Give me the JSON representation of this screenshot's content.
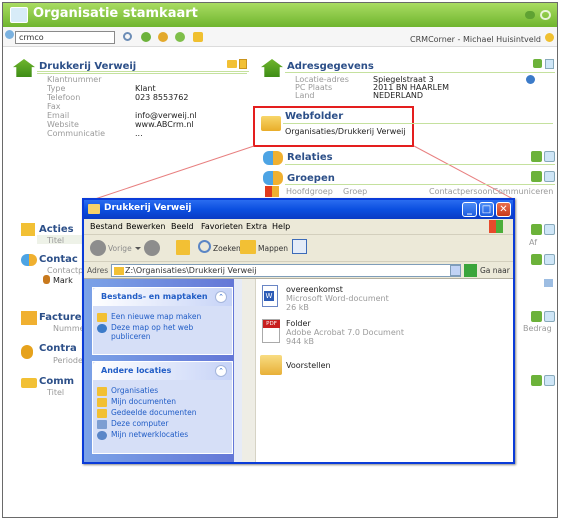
{
  "app": {
    "title": "Organisatie stamkaart",
    "user": "CRMCorner - Michael Huisintveld",
    "search_value": "crmco"
  },
  "colors": {
    "green": "#6fb52e",
    "blue_title": "#2c4f88",
    "highlight": "#e41e1e",
    "xp_blue": "#0b4fe0"
  },
  "org": {
    "name": "Drukkerij Verweij",
    "fields": [
      {
        "label": "Klantnummer",
        "value": ""
      },
      {
        "label": "Type",
        "value": "Klant"
      },
      {
        "label": "Telefoon",
        "value": "023 8553762"
      },
      {
        "label": "Fax",
        "value": ""
      },
      {
        "label": "Email",
        "value": "info@verweij.nl"
      },
      {
        "label": "Website",
        "value": "www.ABCrm.nl"
      },
      {
        "label": "Communicatie",
        "value": "..."
      }
    ]
  },
  "adres": {
    "title": "Adresgegevens",
    "fields": [
      {
        "label": "Locatie-adres",
        "value": "Spiegelstraat 3"
      },
      {
        "label": "PC Plaats",
        "value": "2011 BN HAARLEM"
      },
      {
        "label": "Land",
        "value": "NEDERLAND"
      }
    ]
  },
  "webfolder": {
    "title": "Webfolder",
    "path": "Organisaties/Drukkerij Verweij"
  },
  "relaties": {
    "title": "Relaties"
  },
  "groepen": {
    "title": "Groepen",
    "cols": [
      "Hoofdgroep",
      "Groep",
      "ContactpersoonCommuniceren"
    ]
  },
  "left_partial": {
    "acties": "Acties",
    "acties_sub": "Titel",
    "contact": "Contac",
    "contact_sub": "Contactp",
    "contact_row": "Mark",
    "facturen": "Facture",
    "facturen_sub": "Numme",
    "contract": "Contra",
    "contract_sub": "Periode",
    "comm": "Comm",
    "comm_sub": "Titel"
  },
  "right_partial": {
    "af": "Af",
    "bedrag": "Bedrag"
  },
  "explorer": {
    "title": "Drukkerij Verweij",
    "menu": [
      "Bestand",
      "Bewerken",
      "Beeld",
      "Favorieten",
      "Extra",
      "Help"
    ],
    "toolbar": {
      "back": "Vorige",
      "search": "Zoeken",
      "folders": "Mappen"
    },
    "address_label": "Adres",
    "address_value": "Z:\\Organisaties\\Drukkerij Verweij",
    "go": "Ga naar",
    "task_panel": {
      "title": "Bestands- en maptaken",
      "items": [
        "Een nieuwe map maken",
        "Deze map op het web publiceren"
      ]
    },
    "other_panel": {
      "title": "Andere locaties",
      "items": [
        "Organisaties",
        "Mijn documenten",
        "Gedeelde documenten",
        "Deze computer",
        "Mijn netwerklocaties"
      ]
    },
    "files": [
      {
        "name": "overeenkomst",
        "type": "Microsoft Word-document",
        "size": "26 kB",
        "icon": "word-doc-icon"
      },
      {
        "name": "Folder",
        "type": "Adobe Acrobat 7.0 Document",
        "size": "944 kB",
        "icon": "pdf-icon"
      },
      {
        "name": "Voorstellen",
        "type": "",
        "size": "",
        "icon": "folder-icon"
      }
    ]
  }
}
